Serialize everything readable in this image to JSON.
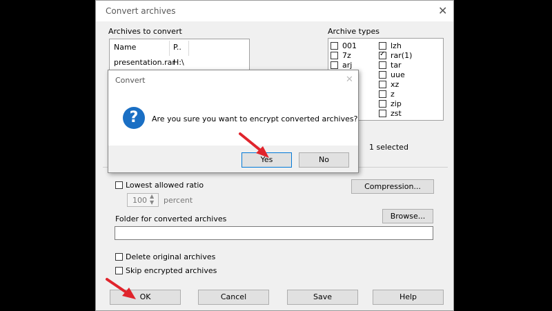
{
  "main_dialog": {
    "title": "Convert archives",
    "close_glyph": "✕",
    "archives_label": "Archives to convert",
    "archive_columns": [
      "Name",
      "P.."
    ],
    "archive_rows": [
      {
        "name": "presentation.rar",
        "path": "H:\\"
      }
    ],
    "types_label": "Archive types",
    "types_left": [
      {
        "label": "001",
        "checked": false
      },
      {
        "label": "7z",
        "checked": false
      },
      {
        "label": "arj",
        "checked": false
      },
      {
        "label": "",
        "checked": false
      }
    ],
    "types_right": [
      {
        "label": "lzh",
        "checked": false
      },
      {
        "label": "rar(1)",
        "checked": true
      },
      {
        "label": "tar",
        "checked": false
      },
      {
        "label": "uue",
        "checked": false
      },
      {
        "label": "xz",
        "checked": false
      },
      {
        "label": "z",
        "checked": false
      },
      {
        "label": "zip",
        "checked": false
      },
      {
        "label": "zst",
        "checked": false
      }
    ],
    "selected_count": "1 selected",
    "lowest_ratio_label": "Lowest allowed ratio",
    "ratio_value": "100",
    "ratio_unit": "percent",
    "compression_button": "Compression...",
    "folder_label": "Folder for converted archives",
    "folder_value": "",
    "browse_button": "Browse...",
    "delete_original_label": "Delete original archives",
    "skip_encrypted_label": "Skip encrypted archives",
    "ok_button": "OK",
    "cancel_button": "Cancel",
    "save_button": "Save",
    "help_button": "Help"
  },
  "confirm_dialog": {
    "title": "Convert",
    "close_glyph": "✕",
    "icon": "question-icon",
    "icon_glyph": "?",
    "message": "Are you sure you want to encrypt converted archives?",
    "yes_button": "Yes",
    "no_button": "No"
  },
  "colors": {
    "accent_blue": "#1a6fc4",
    "annotation_red": "#e0242c"
  }
}
